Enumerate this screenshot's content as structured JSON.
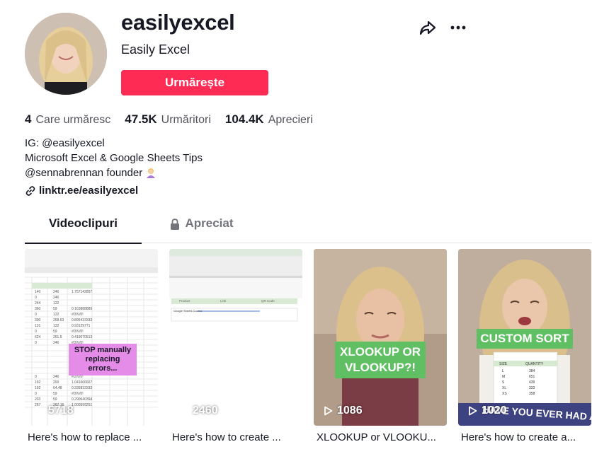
{
  "profile": {
    "username": "easilyexcel",
    "nickname": "Easily Excel",
    "follow_label": "Urmărește"
  },
  "stats": [
    {
      "num": "4",
      "label": "Care urmăresc"
    },
    {
      "num": "47.5K",
      "label": "Urmăritori"
    },
    {
      "num": "104.4K",
      "label": "Aprecieri"
    }
  ],
  "bio": {
    "line1": "IG: @easilyexcel",
    "line2": "Microsoft Excel & Google Sheets Tips",
    "line3": "@sennabrennan founder"
  },
  "link": "linktr.ee/easilyexcel",
  "tabs": {
    "videos": "Videoclipuri",
    "liked": "Apreciat"
  },
  "videos": [
    {
      "views": "5718",
      "caption": "Here's how to replace ...",
      "overlay": "STOP manually replacing errors..."
    },
    {
      "views": "2460",
      "caption": "Here's how to create ..."
    },
    {
      "views": "1086",
      "caption": "XLOOKUP or VLOOKU...",
      "overlay": "XLOOKUP OR VLOOKUP?!"
    },
    {
      "views": "1020",
      "caption": "Here's how to create a...",
      "overlay": "CUSTOM SORT",
      "banner": "HAVE YOU EVER HAD A"
    }
  ],
  "icons": {
    "share": "share-icon",
    "more": "more-icon",
    "link": "link-icon",
    "lock": "lock-icon",
    "play": "play-icon"
  },
  "colors": {
    "accent": "#fe2c55",
    "text": "#161823",
    "secondary": "#73747b"
  }
}
